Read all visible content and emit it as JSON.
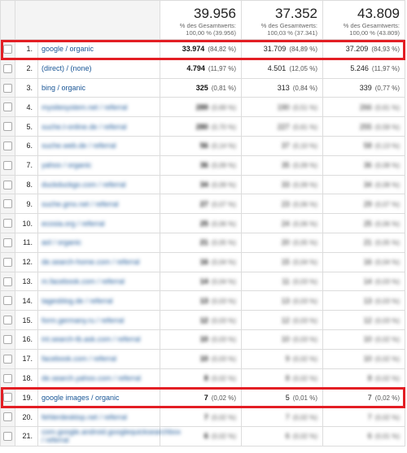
{
  "totals": [
    {
      "value": "39.956",
      "sub1": "% des Gesamtwerts:",
      "sub2": "100,00 % (39.956)"
    },
    {
      "value": "37.352",
      "sub1": "% des Gesamtwerts:",
      "sub2": "100,03 % (37.341)"
    },
    {
      "value": "43.809",
      "sub1": "% des Gesamtwerts:",
      "sub2": "100,00 % (43.809)"
    }
  ],
  "rows": [
    {
      "num": "1.",
      "source": "google / organic",
      "v1": "33.974",
      "p1": "(84,82 %)",
      "v2": "31.709",
      "p2": "(84,89 %)",
      "v3": "37.209",
      "p3": "(84,93 %)",
      "bold1": true
    },
    {
      "num": "2.",
      "source": "(direct) / (none)",
      "v1": "4.794",
      "p1": "(11,97 %)",
      "v2": "4.501",
      "p2": "(12,05 %)",
      "v3": "5.246",
      "p3": "(11,97 %)",
      "bold1": true
    },
    {
      "num": "3.",
      "source": "bing / organic",
      "v1": "325",
      "p1": "(0,81 %)",
      "v2": "313",
      "p2": "(0,84 %)",
      "v3": "339",
      "p3": "(0,77 %)",
      "bold1": true
    },
    {
      "num": "4.",
      "source": "mysitesystem.net / referral",
      "v1": "289",
      "p1": "(0,69 %)",
      "v2": "190",
      "p2": "(0,51 %)",
      "v3": "266",
      "p3": "(0,61 %)",
      "blur": true
    },
    {
      "num": "5.",
      "source": "suche.t-online.de / referral",
      "v1": "280",
      "p1": "(0,70 %)",
      "v2": "227",
      "p2": "(0,61 %)",
      "v3": "255",
      "p3": "(0,58 %)",
      "blur": true
    },
    {
      "num": "6.",
      "source": "suche.web.de / referral",
      "v1": "56",
      "p1": "(0,14 %)",
      "v2": "37",
      "p2": "(0,10 %)",
      "v3": "58",
      "p3": "(0,13 %)",
      "blur": true
    },
    {
      "num": "7.",
      "source": "yahoo / organic",
      "v1": "36",
      "p1": "(0,09 %)",
      "v2": "35",
      "p2": "(0,09 %)",
      "v3": "36",
      "p3": "(0,08 %)",
      "blur": true
    },
    {
      "num": "8.",
      "source": "duckduckgo.com / referral",
      "v1": "34",
      "p1": "(0,09 %)",
      "v2": "33",
      "p2": "(0,09 %)",
      "v3": "34",
      "p3": "(0,08 %)",
      "blur": true
    },
    {
      "num": "9.",
      "source": "suche.gmx.net / referral",
      "v1": "27",
      "p1": "(0,07 %)",
      "v2": "23",
      "p2": "(0,06 %)",
      "v3": "29",
      "p3": "(0,07 %)",
      "blur": true
    },
    {
      "num": "10.",
      "source": "ecosia.org / referral",
      "v1": "25",
      "p1": "(0,06 %)",
      "v2": "24",
      "p2": "(0,06 %)",
      "v3": "25",
      "p3": "(0,06 %)",
      "blur": true
    },
    {
      "num": "11.",
      "source": "aol / organic",
      "v1": "21",
      "p1": "(0,05 %)",
      "v2": "20",
      "p2": "(0,05 %)",
      "v3": "21",
      "p3": "(0,05 %)",
      "blur": true
    },
    {
      "num": "12.",
      "source": "de.search-home.com / referral",
      "v1": "16",
      "p1": "(0,04 %)",
      "v2": "15",
      "p2": "(0,04 %)",
      "v3": "16",
      "p3": "(0,04 %)",
      "blur": true
    },
    {
      "num": "13.",
      "source": "m.facebook.com / referral",
      "v1": "14",
      "p1": "(0,04 %)",
      "v2": "11",
      "p2": "(0,03 %)",
      "v3": "14",
      "p3": "(0,03 %)",
      "blur": true
    },
    {
      "num": "14.",
      "source": "tagesblog.de / referral",
      "v1": "13",
      "p1": "(0,03 %)",
      "v2": "13",
      "p2": "(0,03 %)",
      "v3": "13",
      "p3": "(0,03 %)",
      "blur": true
    },
    {
      "num": "15.",
      "source": "form.germany.ru / referral",
      "v1": "12",
      "p1": "(0,03 %)",
      "v2": "12",
      "p2": "(0,03 %)",
      "v3": "12",
      "p3": "(0,03 %)",
      "blur": true
    },
    {
      "num": "16.",
      "source": "int.search-tb.ask.com / referral",
      "v1": "10",
      "p1": "(0,03 %)",
      "v2": "10",
      "p2": "(0,03 %)",
      "v3": "10",
      "p3": "(0,02 %)",
      "blur": true
    },
    {
      "num": "17.",
      "source": "facebook.com / referral",
      "v1": "10",
      "p1": "(0,03 %)",
      "v2": "9",
      "p2": "(0,02 %)",
      "v3": "10",
      "p3": "(0,02 %)",
      "blur": true
    },
    {
      "num": "18.",
      "source": "de.search.yahoo.com / referral",
      "v1": "8",
      "p1": "(0,02 %)",
      "v2": "8",
      "p2": "(0,02 %)",
      "v3": "8",
      "p3": "(0,02 %)",
      "blur": true
    },
    {
      "num": "19.",
      "source": "google images / organic",
      "v1": "7",
      "p1": "(0,02 %)",
      "v2": "5",
      "p2": "(0,01 %)",
      "v3": "7",
      "p3": "(0,02 %)",
      "bold1": true
    },
    {
      "num": "20.",
      "source": "fehlerdesktop.net / referral",
      "v1": "7",
      "p1": "(0,02 %)",
      "v2": "7",
      "p2": "(0,02 %)",
      "v3": "7",
      "p3": "(0,02 %)",
      "blur": true
    },
    {
      "num": "21.",
      "source": "com.google.android.googlequicksearchbox / referral",
      "v1": "6",
      "p1": "(0,02 %)",
      "v2": "6",
      "p2": "(0,02 %)",
      "v3": "6",
      "p3": "(0,01 %)",
      "blur": true,
      "twoLine": true
    }
  ],
  "colors": {
    "highlight": "#e31e24",
    "link": "#1a5696",
    "grid": "#dcdcdc",
    "checkcol": "#f4f4f4"
  }
}
